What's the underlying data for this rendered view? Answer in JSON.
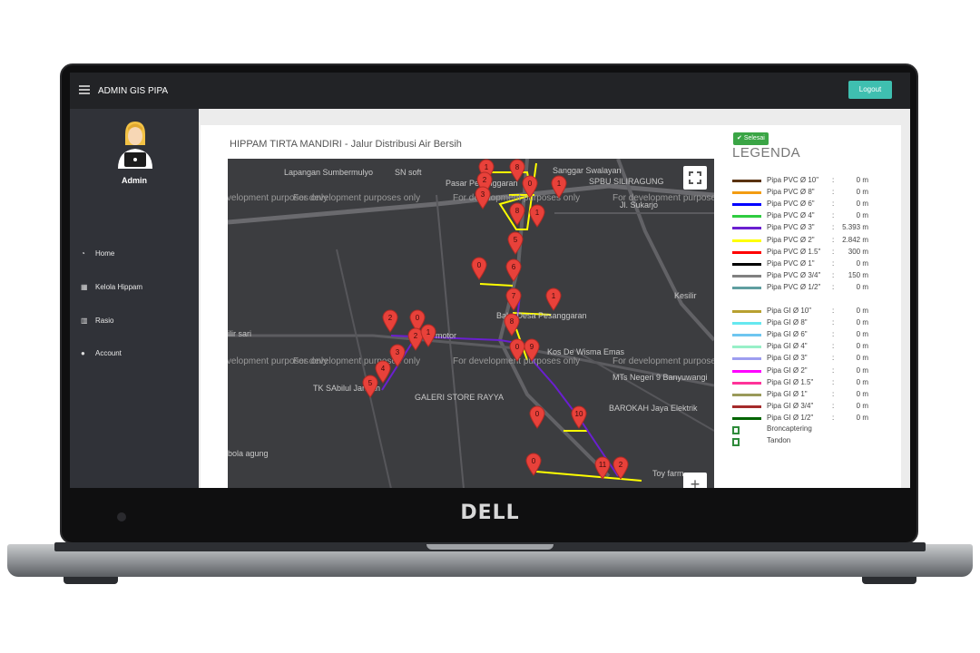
{
  "laptop": {
    "brand": "DELL"
  },
  "topbar": {
    "title": "ADMIN GIS PIPA",
    "logout_label": "Logout"
  },
  "sidebar": {
    "username": "Admin",
    "items": [
      {
        "label": "Home",
        "icon": "dashboard-icon"
      },
      {
        "label": "Kelola Hippam",
        "icon": "grid-icon"
      },
      {
        "label": "Rasio",
        "icon": "bar-chart-icon"
      },
      {
        "label": "Account",
        "icon": "user-icon"
      }
    ]
  },
  "main": {
    "title": "HIPPAM TIRTA MANDIRI - Jalur Distribusi Air Bersih",
    "status_badge": "Selesai",
    "status_badge_icon": "check-icon"
  },
  "map": {
    "labels": [
      "Lapangan Sumbermulyo",
      "SN soft",
      "Pasar Pesanggaran",
      "Sanggar Swalayan",
      "SPBU SILIRAGUNG",
      "Jl. Sukarjo",
      "Kesilir",
      "Balai Desa Pesanggaran",
      "Kos De Wisma Emas",
      "MTs Negeri 9 Banyuwangi",
      "TK SAbilul Jannah",
      "GALERI STORE RAYYA",
      "BAROKAH Jaya Elektrik",
      "ilir sari",
      "Toy farm",
      "bola agung",
      "y motor"
    ],
    "dev_watermark": "For development purposes only",
    "markers": [
      "1",
      "8",
      "2",
      "0",
      "1",
      "3",
      "8",
      "1",
      "5",
      "0",
      "6",
      "7",
      "1",
      "8",
      "2",
      "0",
      "2",
      "1",
      "0",
      "9",
      "3",
      "4",
      "5",
      "0",
      "10",
      "11",
      "2",
      "0"
    ]
  },
  "legend": {
    "title": "LEGENDA",
    "pvc": [
      {
        "name": "Pipa PVC Ø 10\"",
        "value": "0 m",
        "color": "#5a3311"
      },
      {
        "name": "Pipa PVC Ø 8\"",
        "value": "0 m",
        "color": "#f39c12"
      },
      {
        "name": "Pipa PVC Ø 6\"",
        "value": "0 m",
        "color": "#0000ff"
      },
      {
        "name": "Pipa PVC Ø 4\"",
        "value": "0 m",
        "color": "#2ecc40"
      },
      {
        "name": "Pipa PVC Ø 3\"",
        "value": "5.393 m",
        "color": "#6a1fd0"
      },
      {
        "name": "Pipa PVC Ø 2\"",
        "value": "2.842 m",
        "color": "#ffff00"
      },
      {
        "name": "Pipa PVC Ø 1.5\"",
        "value": "300 m",
        "color": "#ff0000"
      },
      {
        "name": "Pipa PVC Ø 1\"",
        "value": "0 m",
        "color": "#000000"
      },
      {
        "name": "Pipa PVC Ø 3/4\"",
        "value": "150 m",
        "color": "#808080"
      },
      {
        "name": "Pipa PVC Ø 1/2\"",
        "value": "0 m",
        "color": "#5f9ea0"
      }
    ],
    "gi": [
      {
        "name": "Pipa GI Ø 10\"",
        "value": "0 m",
        "color": "#b8a030"
      },
      {
        "name": "Pipa GI Ø 8\"",
        "value": "0 m",
        "color": "#66e8f0"
      },
      {
        "name": "Pipa GI Ø 6\"",
        "value": "0 m",
        "color": "#6ec6f0"
      },
      {
        "name": "Pipa GI Ø 4\"",
        "value": "0 m",
        "color": "#98f0c8"
      },
      {
        "name": "Pipa GI Ø 3\"",
        "value": "0 m",
        "color": "#9d9df0"
      },
      {
        "name": "Pipa GI Ø 2\"",
        "value": "0 m",
        "color": "#ff00ff"
      },
      {
        "name": "Pipa GI Ø 1.5\"",
        "value": "0 m",
        "color": "#ff3399"
      },
      {
        "name": "Pipa GI Ø 1\"",
        "value": "0 m",
        "color": "#9a9a5a"
      },
      {
        "name": "Pipa GI Ø 3/4\"",
        "value": "0 m",
        "color": "#a52a2a"
      },
      {
        "name": "Pipa GI Ø 1/2\"",
        "value": "0 m",
        "color": "#006400"
      }
    ],
    "icons": [
      {
        "name": "Broncaptering",
        "icon": "broncaptering-icon"
      },
      {
        "name": "Tandon",
        "icon": "tandon-icon"
      }
    ]
  }
}
